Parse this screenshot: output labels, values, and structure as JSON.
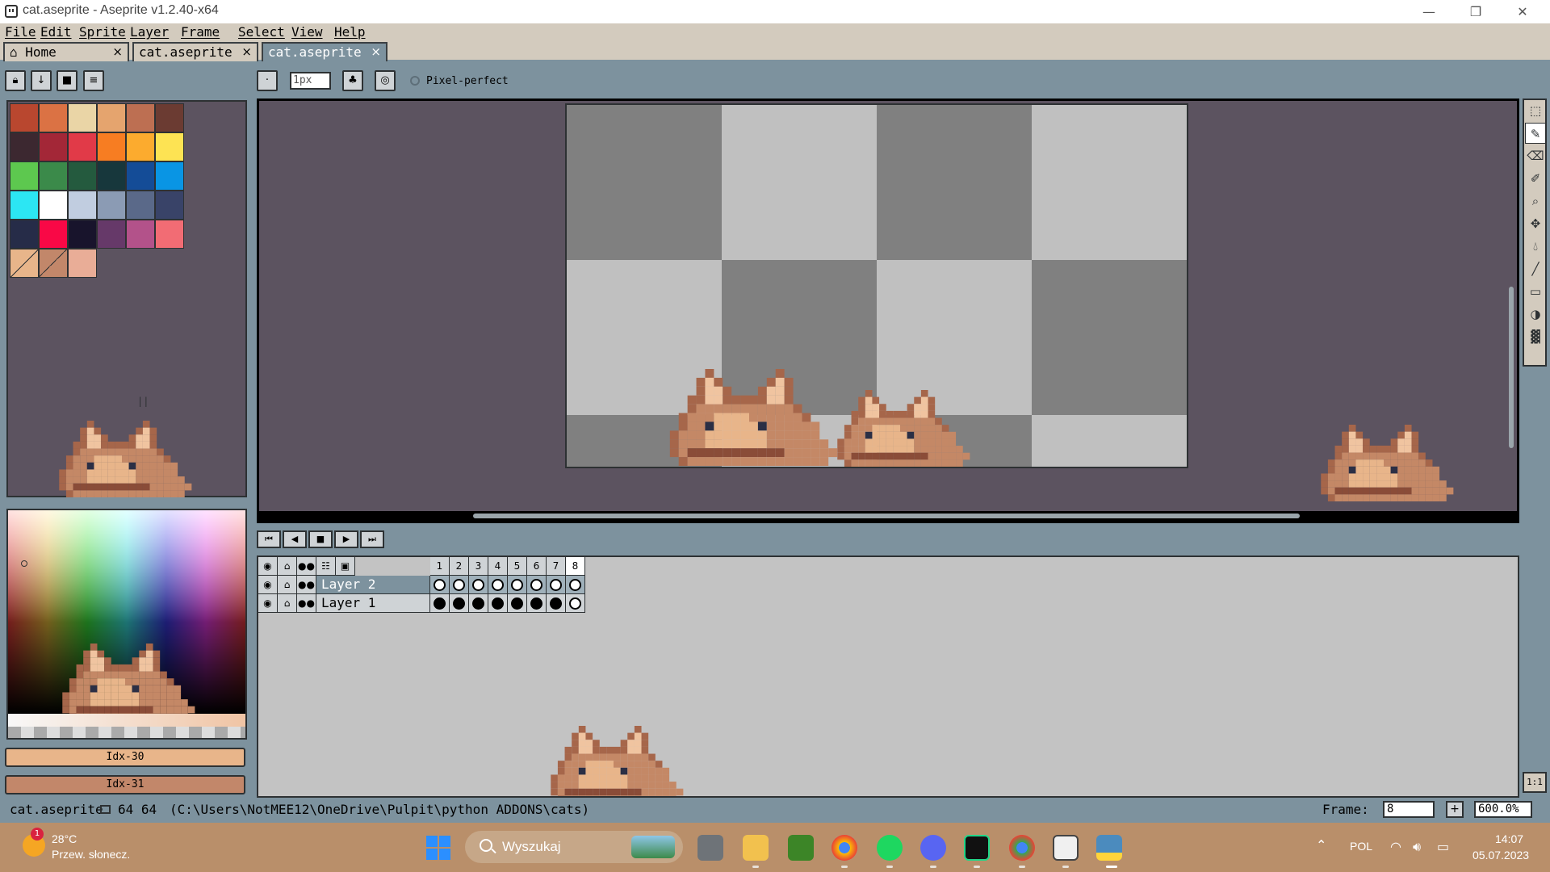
{
  "window": {
    "title": "cat.aseprite - Aseprite v1.2.40-x64",
    "minimize_icon": "minimize-icon",
    "maximize_icon": "restore-icon",
    "close_icon": "close-icon"
  },
  "menu": [
    "File",
    "Edit",
    "Sprite",
    "Layer",
    "Frame",
    "Select",
    "View",
    "Help"
  ],
  "tabs": [
    {
      "label": "Home",
      "icon": "home-icon",
      "close": "×"
    },
    {
      "label": "cat.aseprite",
      "close": "×"
    },
    {
      "label": "cat.aseprite",
      "close": "×",
      "active": true
    }
  ],
  "toolbar": {
    "brush_size_placeholder": "1px",
    "pixel_perfect_label": "Pixel-perfect"
  },
  "palette": {
    "colors": [
      "#b9472f",
      "#db7244",
      "#ead5a6",
      "#e5a46e",
      "#bd6f52",
      "#6b3b32",
      "#3c2830",
      "#a32737",
      "#e13a48",
      "#f77d22",
      "#fcab2e",
      "#fde353",
      "#5dc84f",
      "#3b8a4a",
      "#245a3e",
      "#17373c",
      "#144c97",
      "#0995e4",
      "#2ce6f3",
      "#ffffff",
      "#c1cde0",
      "#8b9bb4",
      "#5a6989",
      "#394368",
      "#262c48",
      "#f90846",
      "#18142c",
      "#663969",
      "#b3528a",
      "#f26c74",
      "#e8b58a",
      "#c2876a",
      "#e9ad97"
    ],
    "foreground_index": 30,
    "background_index": 31
  },
  "color_buttons": {
    "fg_label": "Idx-30",
    "bg_label": "Idx-31",
    "fg_color": "#e8b58a",
    "bg_color": "#c2876a"
  },
  "timeline": {
    "frames": [
      "1",
      "2",
      "3",
      "4",
      "5",
      "6",
      "7",
      "8"
    ],
    "current_frame": "8",
    "layers": [
      {
        "name": "Layer 2",
        "cels": [
          "empty",
          "empty",
          "empty",
          "empty",
          "empty",
          "empty",
          "empty",
          "empty"
        ],
        "selected": true
      },
      {
        "name": "Layer 1",
        "cels": [
          "filled",
          "filled",
          "filled",
          "filled",
          "filled",
          "filled",
          "filled",
          "empty"
        ],
        "selected": false
      }
    ]
  },
  "status": {
    "filename": "cat.aseprite",
    "dimensions": "64 64",
    "path": "(C:\\Users\\NotMEE12\\OneDrive\\Pulpit\\python ADDONS\\cats)",
    "frame_label": "Frame:",
    "frame_value": "8",
    "zoom_value": "600.0%"
  },
  "taskbar": {
    "weather_temp": "28°C",
    "weather_desc": "Przew. słonecz.",
    "weather_badge": "1",
    "search_label": "Wyszukaj",
    "language": "POL",
    "time": "14:07",
    "date": "05.07.2023"
  }
}
